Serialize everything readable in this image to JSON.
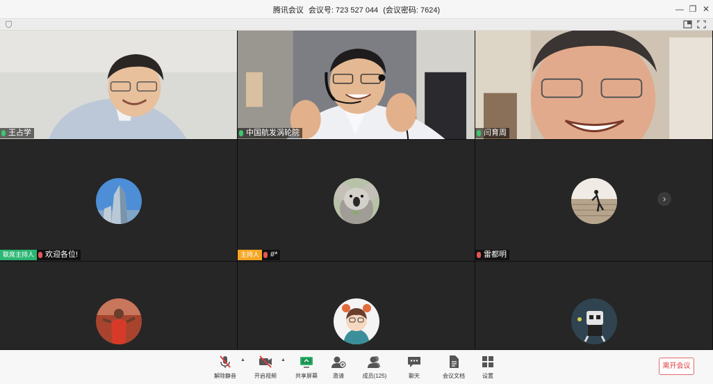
{
  "window": {
    "app_name": "腾讯会议",
    "meeting_id_label": "会议号: 723 527 044",
    "password_label": "(会议密码: 7624)"
  },
  "tiles": [
    {
      "name": "王占学",
      "mic": "on"
    },
    {
      "name": "中国航发涡轮院",
      "mic": "on"
    },
    {
      "name": "闫育周",
      "mic": "on"
    },
    {
      "tag": "联席主持人",
      "name": "欢迎各位!",
      "mic": "muted"
    },
    {
      "tag": "主持人",
      "name": "#*",
      "mic": "muted"
    },
    {
      "name": "雷都明",
      "mic": "muted"
    },
    {
      "name": ""
    },
    {
      "name": ""
    },
    {
      "name": ""
    }
  ],
  "toolbar": {
    "unmute": "解除静音",
    "start_video": "开启视频",
    "share_screen": "共享屏幕",
    "invite": "邀请",
    "members": "成员(125)",
    "chat": "聊天",
    "documents": "会议文档",
    "settings": "设置",
    "leave": "离开会议"
  },
  "colors": {
    "cohost_tag": "#2bb673",
    "host_tag": "#f5a623",
    "leave_text": "#e03c3c",
    "share_green": "#2db36b"
  }
}
